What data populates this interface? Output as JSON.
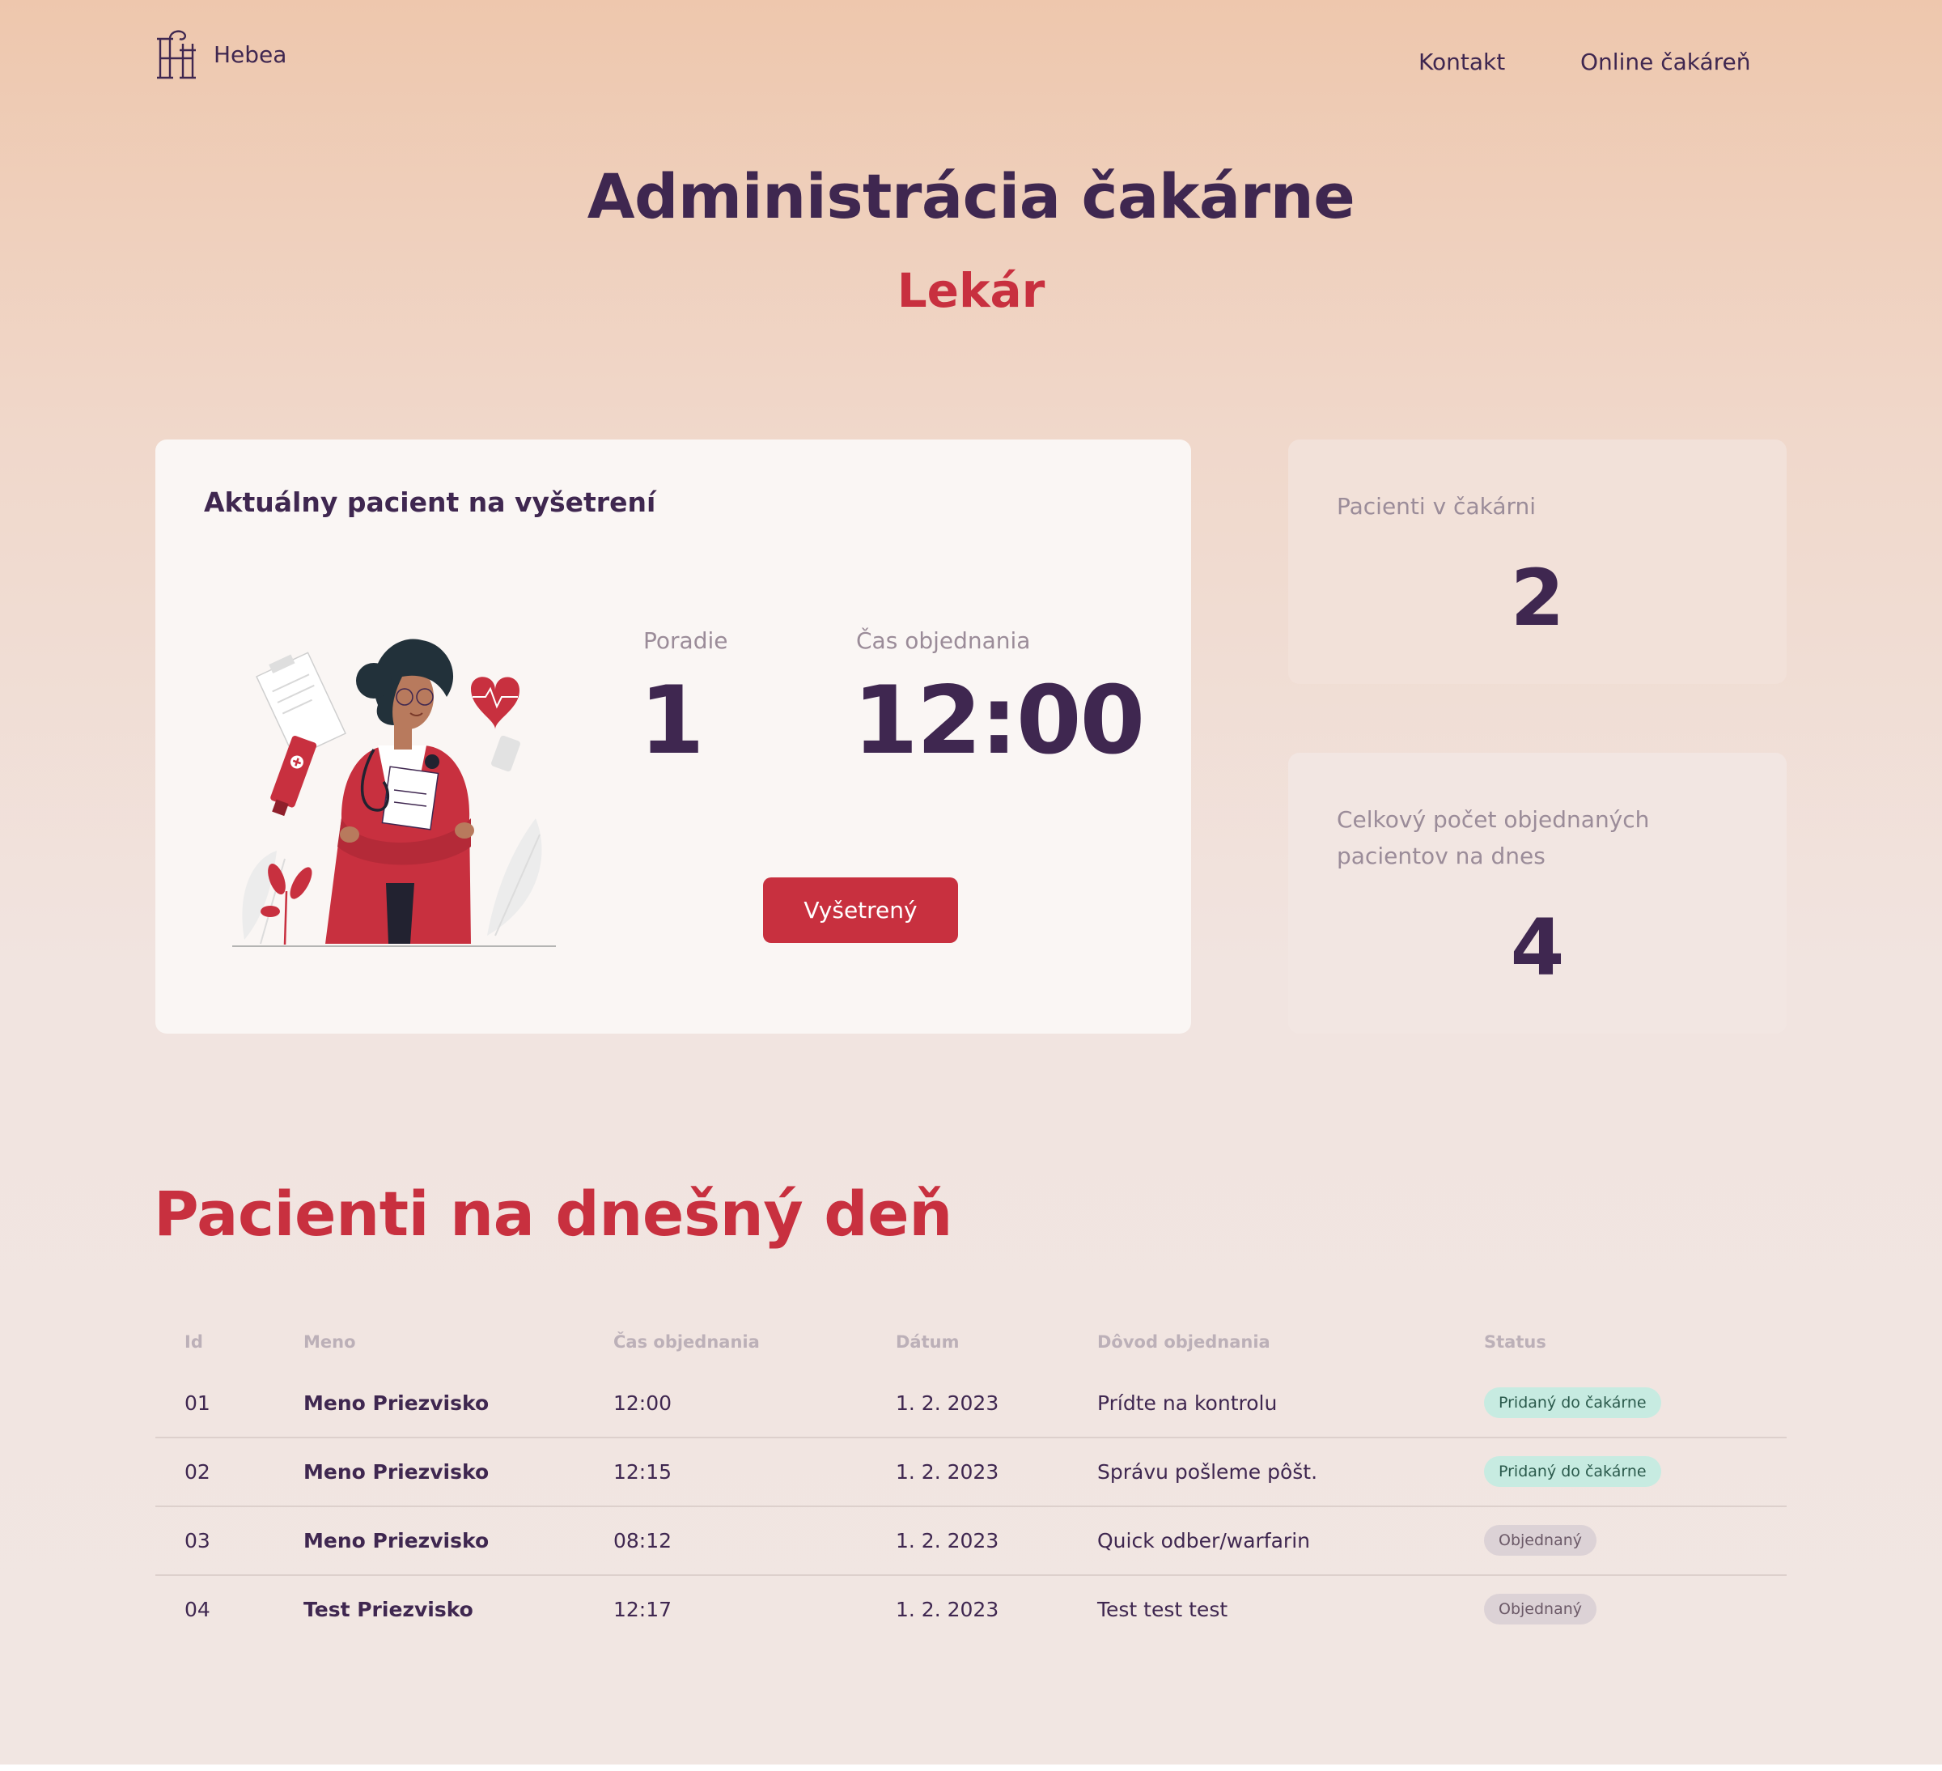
{
  "header": {
    "logo_text": "Hebea",
    "nav": [
      {
        "label": "Kontakt"
      },
      {
        "label": "Online čakáreň"
      }
    ]
  },
  "page": {
    "title": "Administrácia čakárne",
    "subtitle": "Lekár"
  },
  "current_patient": {
    "title": "Aktuálny pacient na vyšetrení",
    "order_label": "Poradie",
    "order_value": "1",
    "time_label": "Čas objednania",
    "time_value": "12:00",
    "button_label": "Vyšetrený"
  },
  "stats": {
    "waiting_label": "Pacienti v čakárni",
    "waiting_value": "2",
    "total_label": "Celkový počet objednaných pacientov na dnes",
    "total_value": "4"
  },
  "patients_section": {
    "title": "Pacienti na dnešný deň",
    "columns": [
      "Id",
      "Meno",
      "Čas objednania",
      "Dátum",
      "Dôvod objednania",
      "Status"
    ],
    "rows": [
      {
        "id": "01",
        "name": "Meno Priezvisko",
        "time": "12:00",
        "date": "1. 2. 2023",
        "reason": "Prídte na kontrolu",
        "status": "Pridaný do čakárne"
      },
      {
        "id": "02",
        "name": "Meno Priezvisko",
        "time": "12:15",
        "date": "1. 2. 2023",
        "reason": "Správu pošleme pôšt.",
        "status": "Pridaný do čakárne"
      },
      {
        "id": "03",
        "name": "Meno Priezvisko",
        "time": "08:12",
        "date": "1. 2. 2023",
        "reason": "Quick odber/warfarin",
        "status": "Objednaný"
      },
      {
        "id": "04",
        "name": "Test Priezvisko",
        "time": "12:17",
        "date": "1. 2. 2023",
        "reason": "Test test test",
        "status": "Objednaný"
      }
    ]
  },
  "colors": {
    "primary_dark": "#3f2750",
    "accent_red": "#c8303f",
    "muted_label": "#9b8c99",
    "badge_added_bg": "#c7ebe1",
    "badge_ordered_bg": "#dcd2d6"
  },
  "icons": {
    "logo": "hebea-logo-icon",
    "illustration": "doctor-illustration"
  }
}
